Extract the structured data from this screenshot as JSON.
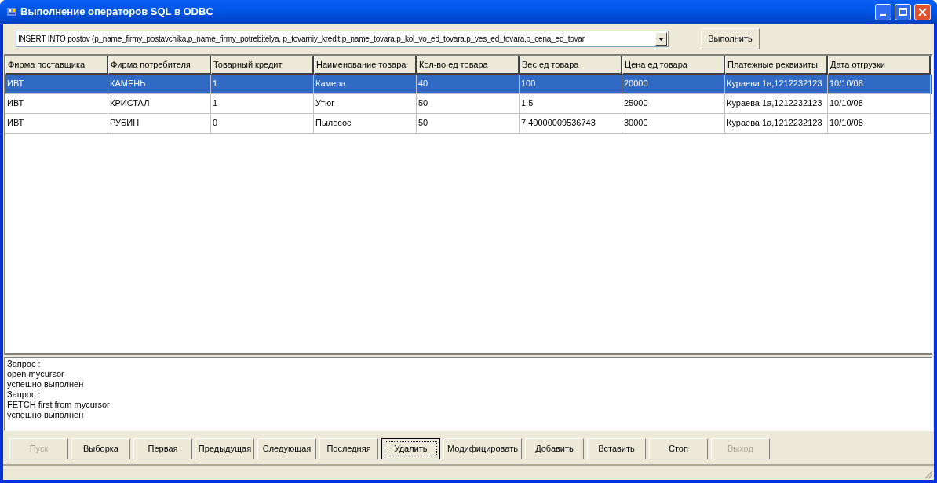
{
  "window": {
    "title": "Выполнение операторов SQL в ODBC"
  },
  "query_box": {
    "value": "INSERT INTO postov (p_name_firmy_postavchika,p_name_firmy_potrebitelya, p_tovarniy_kredit,p_name_tovara,p_kol_vo_ed_tovara,p_ves_ed_tovara,p_cena_ed_tovar"
  },
  "execute_button": {
    "label": "Выполнить"
  },
  "table": {
    "columns": [
      "Фирма поставщика",
      "Фирма потребителя",
      "Товарный кредит",
      "Наименование товара",
      "Кол-во ед товара",
      "Вес ед товара",
      "Цена ед товара",
      "Платежные реквизиты",
      "Дата отгрузки"
    ],
    "rows": [
      {
        "selected": true,
        "cells": [
          "ИВТ",
          "КАМЕНЬ",
          "1",
          "Камера",
          "40",
          "100",
          "20000",
          "Кураева 1а,1212232123",
          "10/10/08"
        ]
      },
      {
        "selected": false,
        "cells": [
          "ИВТ",
          "КРИСТАЛ",
          "1",
          "Утюг",
          "50",
          "1,5",
          "25000",
          "Кураева 1а,1212232123",
          "10/10/08"
        ]
      },
      {
        "selected": false,
        "cells": [
          "ИВТ",
          "РУБИН",
          "0",
          "Пылесос",
          "50",
          "7,40000009536743",
          "30000",
          "Кураева 1а,1212232123",
          "10/10/08"
        ]
      }
    ]
  },
  "log": [
    "Запрос :",
    "open mycursor",
    "успешно выполнен",
    "Запрос :",
    "FETCH first from mycursor",
    "успешно выполнен"
  ],
  "buttons": [
    {
      "label": "Пуск",
      "disabled": true,
      "focused": false
    },
    {
      "label": "Выборка",
      "disabled": false,
      "focused": false
    },
    {
      "label": "Первая",
      "disabled": false,
      "focused": false
    },
    {
      "label": "Предыдущая",
      "disabled": false,
      "focused": false
    },
    {
      "label": "Следующая",
      "disabled": false,
      "focused": false
    },
    {
      "label": "Последняя",
      "disabled": false,
      "focused": false
    },
    {
      "label": "Удалить",
      "disabled": false,
      "focused": true
    },
    {
      "label": "Модифицировать",
      "disabled": false,
      "focused": false
    },
    {
      "label": "Добавить",
      "disabled": false,
      "focused": false
    },
    {
      "label": "Вставить",
      "disabled": false,
      "focused": false
    },
    {
      "label": "Стоп",
      "disabled": false,
      "focused": false
    },
    {
      "label": "Выход",
      "disabled": true,
      "focused": false
    }
  ]
}
